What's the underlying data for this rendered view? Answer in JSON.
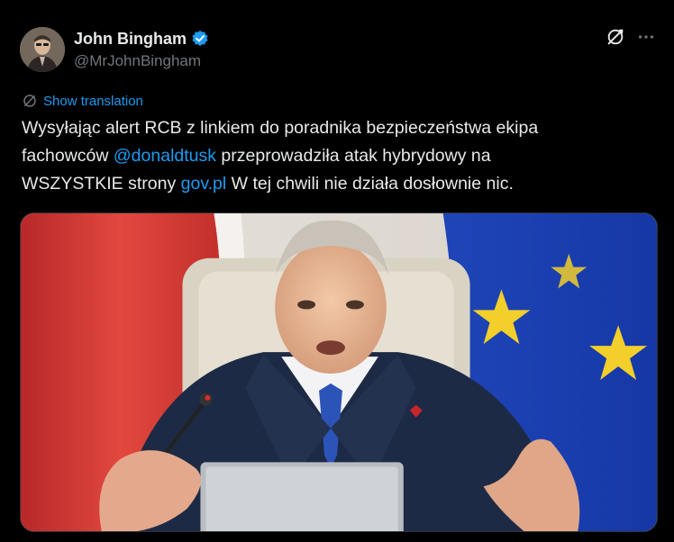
{
  "author": {
    "display_name": "John Bingham",
    "handle": "@MrJohnBingham",
    "verified": true,
    "avatar_icon": "avatar-photo"
  },
  "actions": {
    "grok_icon": "grok-icon",
    "more_icon": "more-icon"
  },
  "translation": {
    "label": "Show translation",
    "icon": "translate-icon"
  },
  "tweet": {
    "line1": "Wysyłając alert RCB z linkiem do poradnika bezpieczeństwa ekipa",
    "line2_pre": "fachowców ",
    "mention": "@donaldtusk",
    "line2_post": " przeprowadziła atak hybrydowy na",
    "line3_pre": "WSZYSTKIE strony ",
    "link": "gov.pl",
    "line3_post": " W tej chwili nie działa dosłownie nic."
  },
  "media": {
    "description_icon": "photo-of-man-speaking-at-microphone"
  },
  "colors": {
    "background": "#000000",
    "text": "#e7e9ea",
    "secondary": "#71767b",
    "link": "#1d9bf0",
    "verified": "#1d9bf0"
  }
}
